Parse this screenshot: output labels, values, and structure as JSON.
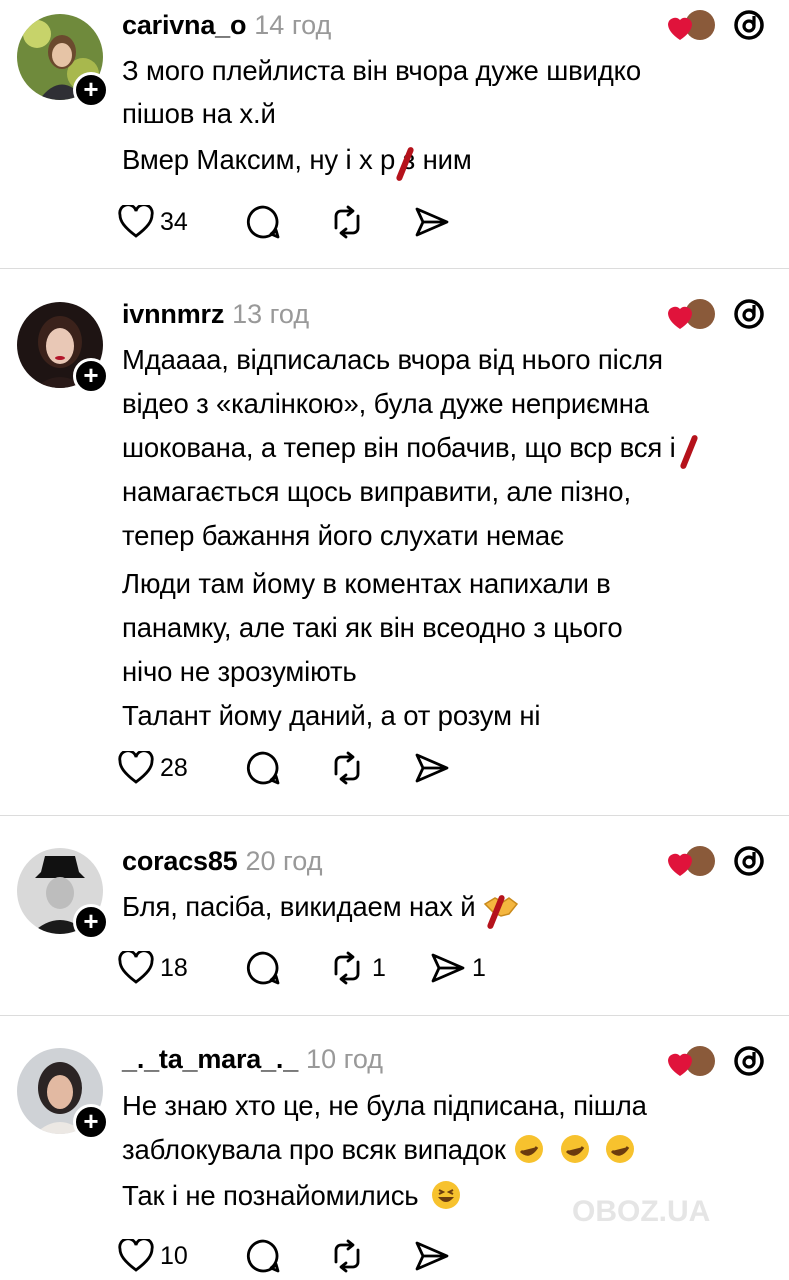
{
  "posts": [
    {
      "username": "carivna_o",
      "time": "14 год",
      "lines": [
        "З мого плейлиста він вчора дуже швидко",
        "пішов на х.й",
        "Вмер Максим, ну і х р з ним"
      ],
      "likes": "34",
      "reposts": "",
      "shares": ""
    },
    {
      "username": "ivnnmrz",
      "time": "13 год",
      "lines": [
        "Мдаааа, відписалась вчора від нього після",
        "відео з «калінкою», була дуже неприємна",
        "шокована, а тепер він побачив, що вср вся і",
        "намагається щось виправити, але пізно,",
        "тепер бажання його слухати немає",
        "Люди там йому в коментах напихали в",
        "панамку, але такі як він всеодно з цього",
        "нічо не зрозуміють",
        "Талант йому даний, а от розум ні"
      ],
      "likes": "28",
      "reposts": "",
      "shares": ""
    },
    {
      "username": "coracs85",
      "time": "20 год",
      "lines": [
        "Бля, пасіба, викидаем нах й"
      ],
      "likes": "18",
      "reposts": "1",
      "shares": "1"
    },
    {
      "username": "_._ta_mara_._",
      "time": "10 год",
      "lines": [
        "Не знаю хто це, не була підписана, пішла",
        "заблокувала про всяк випадок",
        "Так і не познайомились"
      ],
      "likes": "10",
      "reposts": "",
      "shares": ""
    }
  ],
  "icons": {
    "like": "heart-icon",
    "comment": "comment-icon",
    "repost": "repost-icon",
    "share": "share-icon",
    "threads": "threads-logo-icon",
    "follow": "plus-icon"
  },
  "colors": {
    "text": "#000000",
    "muted": "#999999",
    "divider": "#dcdcdc",
    "heart": "#e0133b",
    "censor": "#b5121b"
  },
  "watermark": "OBOZ.UA"
}
